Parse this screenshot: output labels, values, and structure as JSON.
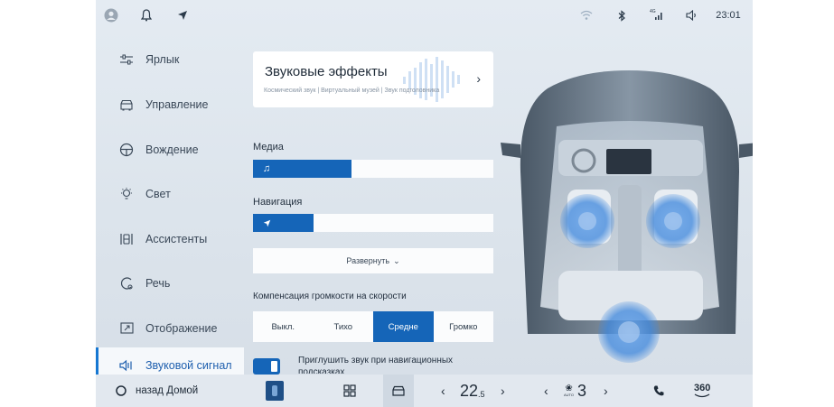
{
  "status": {
    "time": "23:01",
    "signal_label": "4G"
  },
  "sidebar": {
    "items": [
      {
        "label": "Ярлык",
        "icon": "sliders-icon"
      },
      {
        "label": "Управление",
        "icon": "car-icon"
      },
      {
        "label": "Вождение",
        "icon": "steering-wheel-icon"
      },
      {
        "label": "Свет",
        "icon": "light-icon"
      },
      {
        "label": "Ассистенты",
        "icon": "assist-icon"
      },
      {
        "label": "Речь",
        "icon": "voice-icon"
      },
      {
        "label": "Отображение",
        "icon": "display-icon"
      },
      {
        "label": "Звуковой сигнал",
        "icon": "speaker-icon",
        "active": true
      }
    ]
  },
  "sound_effects": {
    "title": "Звуковые эффекты",
    "subtitle": "Космический звук | Виртуальный музей | Звук подголовника"
  },
  "media": {
    "label": "Медиа",
    "level": 0.41
  },
  "navigation": {
    "label": "Навигация",
    "level": 0.25
  },
  "expand_label": "Развернуть",
  "speed_comp": {
    "label": "Компенсация громкости на скорости",
    "options": [
      "Выкл.",
      "Тихо",
      "Средне",
      "Громко"
    ],
    "selected": 2
  },
  "duck_nav": {
    "text": "Приглушить звук при навигационных подсказках",
    "on": true
  },
  "bottom": {
    "home_label": "назад Домой",
    "temp_left": "22",
    "temp_left_decimal": ".5",
    "fan_speed": "3",
    "fan_label": "AUTO",
    "view360": "360"
  },
  "accent": "#1565b8"
}
